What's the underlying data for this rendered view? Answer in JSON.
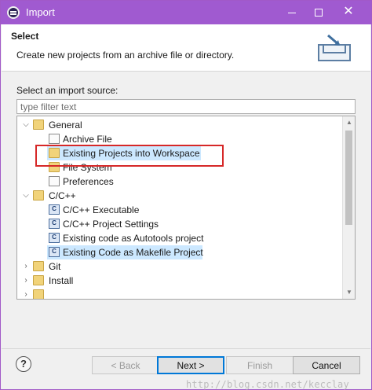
{
  "window": {
    "title": "Import",
    "accent": "#a05ad0"
  },
  "header": {
    "title": "Select",
    "description": "Create new projects from an archive file or directory."
  },
  "source": {
    "label": "Select an import source:",
    "filter_placeholder": "type filter text"
  },
  "tree": {
    "items": [
      {
        "label": "General",
        "expanded": true,
        "level": 0,
        "icon": "folder-open-icon"
      },
      {
        "label": "Archive File",
        "level": 1,
        "icon": "archive-file-icon"
      },
      {
        "label": "Existing Projects into Workspace",
        "level": 1,
        "icon": "folder-project-icon",
        "selected": true
      },
      {
        "label": "File System",
        "level": 1,
        "icon": "folder-icon"
      },
      {
        "label": "Preferences",
        "level": 1,
        "icon": "preferences-icon"
      },
      {
        "label": "C/C++",
        "expanded": true,
        "level": 0,
        "icon": "folder-open-icon"
      },
      {
        "label": "C/C++ Executable",
        "level": 1,
        "icon": "c-executable-icon"
      },
      {
        "label": "C/C++ Project Settings",
        "level": 1,
        "icon": "c-settings-icon"
      },
      {
        "label": "Existing code as Autotools project",
        "level": 1,
        "icon": "c-project-icon"
      },
      {
        "label": "Existing Code as Makefile Project",
        "level": 1,
        "icon": "c-project-icon",
        "selected": true
      },
      {
        "label": "Git",
        "expanded": false,
        "level": 0,
        "icon": "folder-icon"
      },
      {
        "label": "Install",
        "expanded": false,
        "level": 0,
        "icon": "folder-icon"
      }
    ]
  },
  "buttons": {
    "back": "< Back",
    "next": "Next >",
    "finish": "Finish",
    "cancel": "Cancel",
    "help": "?"
  },
  "watermark": "http://blog.csdn.net/kecclay"
}
